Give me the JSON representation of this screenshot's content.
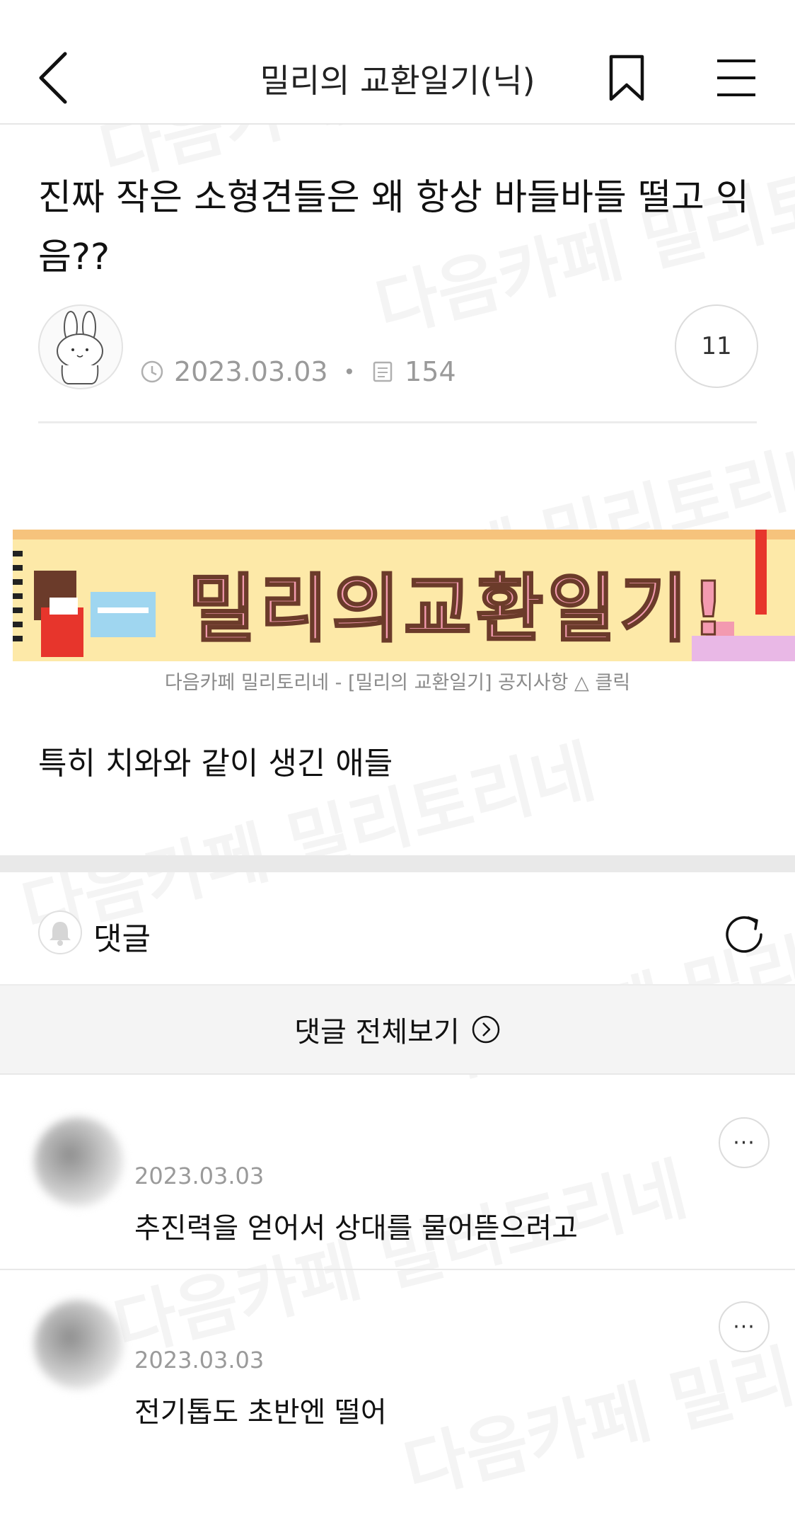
{
  "header": {
    "cafe_title": "밀리의 교환일기(닉)"
  },
  "post": {
    "title": "진짜 작은 소형견들은 왜 항상 바들바들 떨고 익음??",
    "date": "2023.03.03",
    "views": "154",
    "comment_count": "11",
    "banner_text": "밀리의교환일기!",
    "banner_caption": "다음카페 밀리토리네 - [밀리의 교환일기] 공지사항 △ 클릭",
    "body": "특히 치와와 같이 생긴 애들"
  },
  "comments_section": {
    "label": "댓글",
    "view_all": "댓글 전체보기"
  },
  "comments": [
    {
      "date": "2023.03.03",
      "text": "추진력을 얻어서 상대를 물어뜯으려고",
      "more": "···"
    },
    {
      "date": "2023.03.03",
      "text": "전기톱도 초반엔 떨어",
      "more": "···"
    }
  ],
  "watermark": "다음카페 밀리토리네",
  "colors": {
    "banner_bg": "#fde9a8",
    "banner_pink": "#f39ab0",
    "banner_brown": "#6b3b2a",
    "muted": "#9a9a9a"
  },
  "icons": [
    "back-arrow-icon",
    "bookmark-icon",
    "menu-icon",
    "clock-icon",
    "views-icon",
    "bell-icon",
    "refresh-icon",
    "chevron-right-circle-icon",
    "more-icon"
  ]
}
